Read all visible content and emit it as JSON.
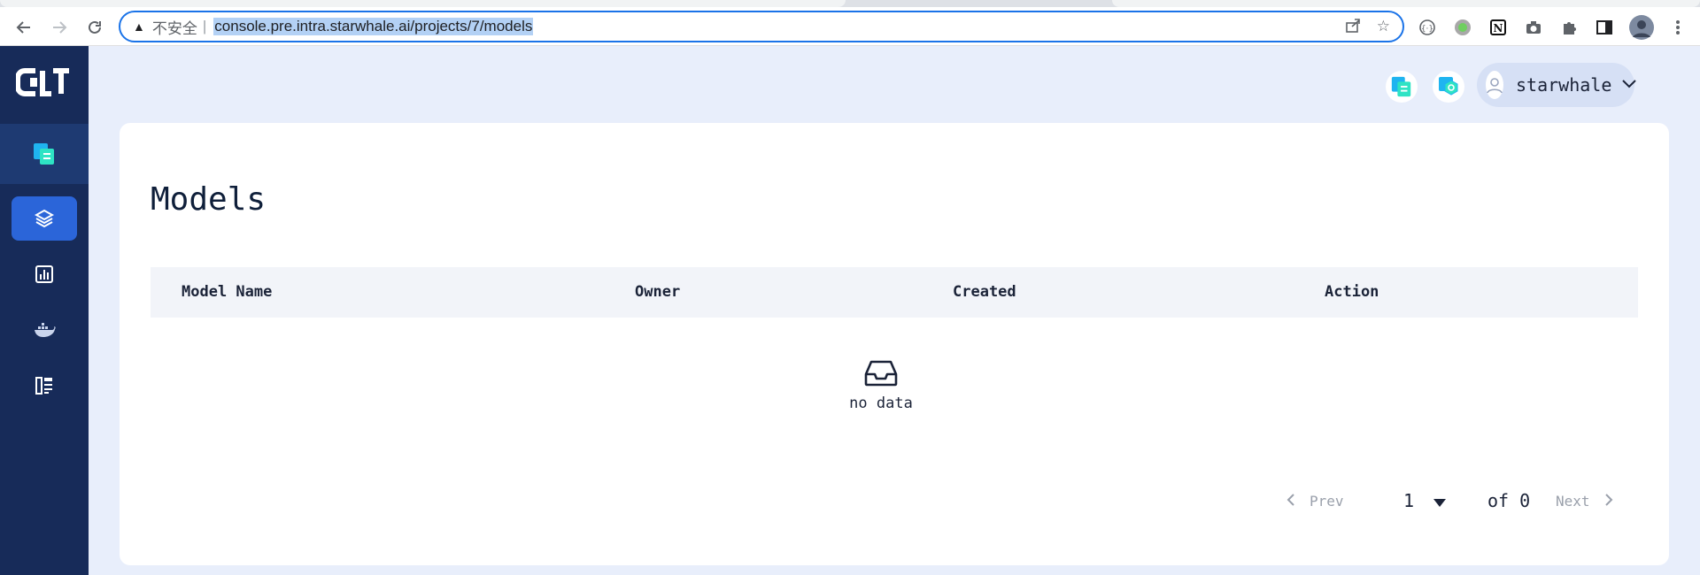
{
  "browser": {
    "insecure_label": "不安全",
    "url": "console.pre.intra.starwhale.ai/projects/7/models"
  },
  "header": {
    "username": "starwhale"
  },
  "page": {
    "title": "Models",
    "columns": [
      "Model Name",
      "Owner",
      "Created",
      "Action"
    ],
    "empty_text": "no data"
  },
  "pagination": {
    "prev_label": "Prev",
    "current_page": "1",
    "of_label": "of 0",
    "next_label": "Next"
  },
  "colors": {
    "sidebar": "#172b59",
    "sidebar_active": "#2b65d9",
    "page_bg": "#e8eefb"
  },
  "icons": [
    "back-icon",
    "forward-icon",
    "reload-icon",
    "warning-icon",
    "share-icon",
    "star-icon",
    "extension-icon",
    "puzzle-icon",
    "sidepanel-icon",
    "profile-icon",
    "menu-icon",
    "models-icon",
    "evaluation-icon",
    "runtime-icon",
    "datasets-icon",
    "project-icon",
    "inbox-icon",
    "chevron-down-icon",
    "chevron-left-icon",
    "chevron-right-icon",
    "caret-down-icon"
  ]
}
